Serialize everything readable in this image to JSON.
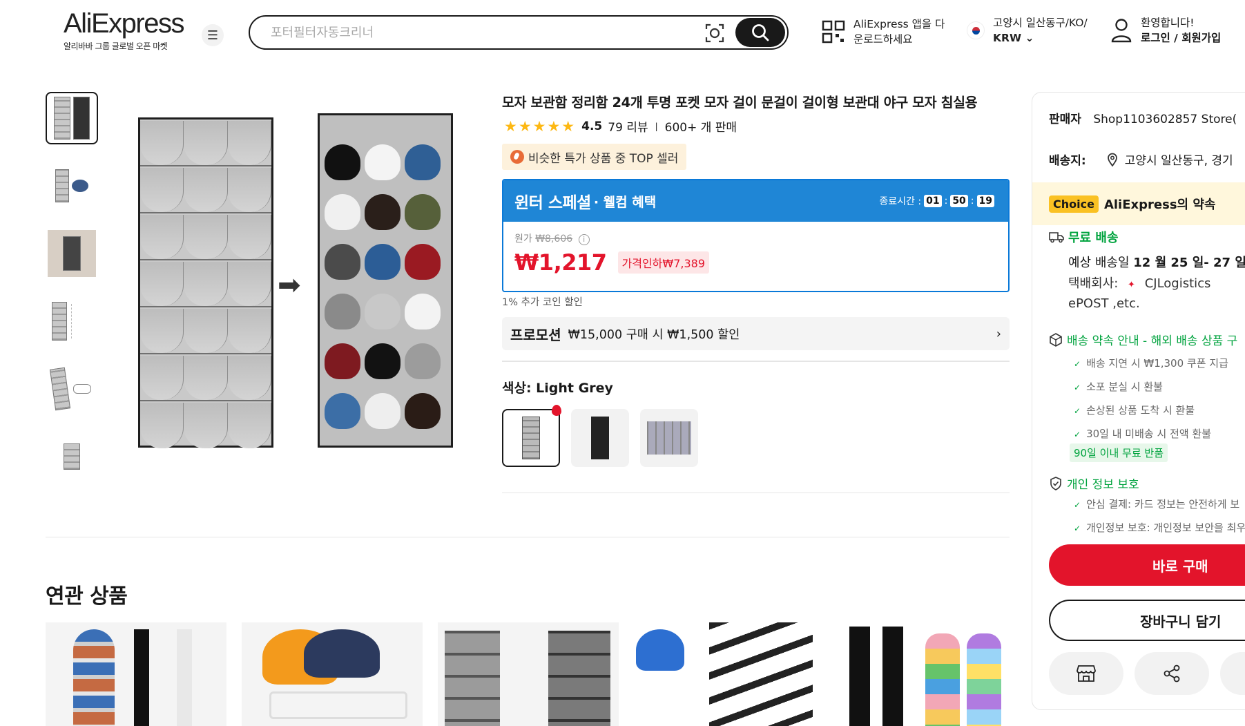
{
  "header": {
    "logo": "AliExpress",
    "logo_sub": "알리바바 그룹 글로벌 오픈 마켓",
    "search_placeholder": "포터필터자동크리너",
    "app_line1": "AliExpress 앱을 다",
    "app_line2": "운로드하세요",
    "region_line": "고양시 일산동구/KO/",
    "currency": "KRW",
    "welcome": "환영합니다!",
    "login": "로그인 / 회원가입"
  },
  "product": {
    "title": "모자 보관함 정리함 24개 투명 포켓 모자 걸이 문걸이 걸이형 보관대 야구 모자 침실용",
    "rating": "4.5",
    "reviews": "79 리뷰",
    "sold": "600+ 개 판매",
    "top_badge": "비슷한 특가 상품 중 TOP 셀러",
    "promo_title": "윈터 스페셜",
    "promo_sub": "· 웰컴 혜택",
    "timer_label": "종료시간 :",
    "timer_h": "01",
    "timer_m": "50",
    "timer_s": "19",
    "orig_label": "원가",
    "orig_price": "₩8,606",
    "price": "₩1,217",
    "discount": "가격인하₩7,389",
    "coin": "1% 추가 코인 할인",
    "promotion_label": "프로모션",
    "promotion_text": "₩15,000 구매 시 ₩1,500 할인",
    "color_label": "색상: Light Grey"
  },
  "related": {
    "title": "연관 상품"
  },
  "panel": {
    "seller_label": "판매자",
    "seller": "Shop1103602857 Store(",
    "ship_label": "배송지:",
    "ship_to": "고양시 일산동구, 경기",
    "choice_tag": "Choice",
    "choice_text": "AliExpress의 약속",
    "free_ship": "무료 배송",
    "eta_prefix": "예상 배송일",
    "eta_dates": "12 월 25 일- 27 일",
    "carrier_label": "택배회사:",
    "carrier": "CJLogistics",
    "carrier2": "ePOST ,etc.",
    "guarantee_title": "배송 약속 안내 - 해외 배송 상품 구",
    "guarantees": [
      "배송 지연 시 ₩1,300 쿠폰 지급",
      "소포 분실 시 환불",
      "손상된 상품 도착 시 환불",
      "30일 내 미배송 시 전액 환불"
    ],
    "return_badge": "90일 이내 무료 반품",
    "privacy_title": "개인 정보 보호",
    "privacy_items": [
      "안심 결제: 카드 정보는 안전하게 보",
      "개인정보 보호: 개인정보 보안을 최우"
    ],
    "buy_now": "바로 구매",
    "add_cart": "장바구니 담기"
  }
}
